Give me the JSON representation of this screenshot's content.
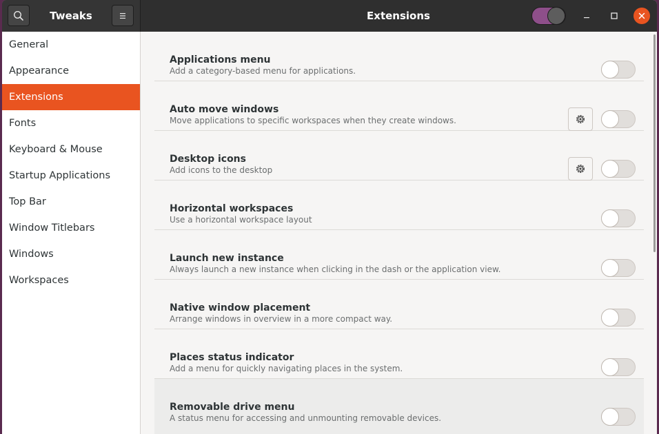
{
  "header": {
    "app_title": "Tweaks",
    "page_title": "Extensions",
    "extensions_master_switch_on": true
  },
  "sidebar": {
    "items": [
      {
        "label": "General",
        "active": false
      },
      {
        "label": "Appearance",
        "active": false
      },
      {
        "label": "Extensions",
        "active": true
      },
      {
        "label": "Fonts",
        "active": false
      },
      {
        "label": "Keyboard & Mouse",
        "active": false
      },
      {
        "label": "Startup Applications",
        "active": false
      },
      {
        "label": "Top Bar",
        "active": false
      },
      {
        "label": "Window Titlebars",
        "active": false
      },
      {
        "label": "Windows",
        "active": false
      },
      {
        "label": "Workspaces",
        "active": false
      }
    ]
  },
  "extensions": [
    {
      "name": "Applications menu",
      "description": "Add a category-based menu for applications.",
      "has_settings": false,
      "enabled": false
    },
    {
      "name": "Auto move windows",
      "description": "Move applications to specific workspaces when they create windows.",
      "has_settings": true,
      "enabled": false
    },
    {
      "name": "Desktop icons",
      "description": "Add icons to the desktop",
      "has_settings": true,
      "enabled": false
    },
    {
      "name": "Horizontal workspaces",
      "description": "Use a horizontal workspace layout",
      "has_settings": false,
      "enabled": false
    },
    {
      "name": "Launch new instance",
      "description": "Always launch a new instance when clicking in the dash or the application view.",
      "has_settings": false,
      "enabled": false
    },
    {
      "name": "Native window placement",
      "description": "Arrange windows in overview in a more compact way.",
      "has_settings": false,
      "enabled": false
    },
    {
      "name": "Places status indicator",
      "description": "Add a menu for quickly navigating places in the system.",
      "has_settings": false,
      "enabled": false
    },
    {
      "name": "Removable drive menu",
      "description": "A status menu for accessing and unmounting removable devices.",
      "has_settings": false,
      "enabled": false
    }
  ],
  "colors": {
    "accent": "#e95420",
    "header_bg": "#2f2f2f",
    "master_switch_on": "#8e4f8a",
    "desktop_bg": "#5a2b4f"
  },
  "icons": {
    "search": "search-icon",
    "menu": "hamburger-menu-icon",
    "settings": "gear-icon",
    "minimize": "minimize-icon",
    "maximize": "maximize-icon",
    "close": "close-icon"
  }
}
